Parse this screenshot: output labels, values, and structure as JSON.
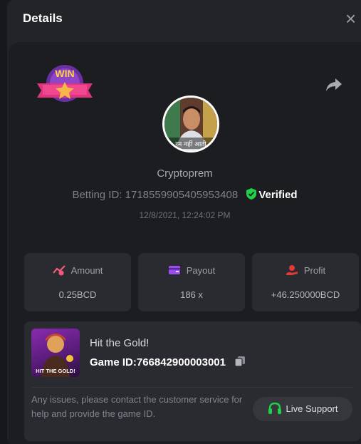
{
  "modal": {
    "title": "Details"
  },
  "bet": {
    "username": "Cryptoprem",
    "betting_id_label": "Betting ID:",
    "betting_id": "1718559905405953408",
    "verified_label": "Verified",
    "datetime": "12/8/2021, 12:24:02 PM",
    "badge_text": "WIN",
    "avatar_caption": "रम नहीं आती"
  },
  "stats": [
    {
      "label": "Amount",
      "value": "0.25BCD",
      "icon": "amount-icon"
    },
    {
      "label": "Payout",
      "value": "186 x",
      "icon": "payout-icon"
    },
    {
      "label": "Profit",
      "value": "+46.250000BCD",
      "icon": "profit-icon"
    }
  ],
  "game": {
    "title": "Hit the Gold!",
    "id_label": "Game ID:",
    "id": "766842900003001",
    "thumb_text": "HIT THE GOLD!",
    "notice": "Any issues, please contact the customer service for help and provide the game ID.",
    "support_label": "Live Support"
  },
  "colors": {
    "accent_green": "#1fd14a",
    "profit_red": "#e23a3a",
    "payout_purple": "#9b4df0",
    "amount_pink": "#f25a7a"
  }
}
